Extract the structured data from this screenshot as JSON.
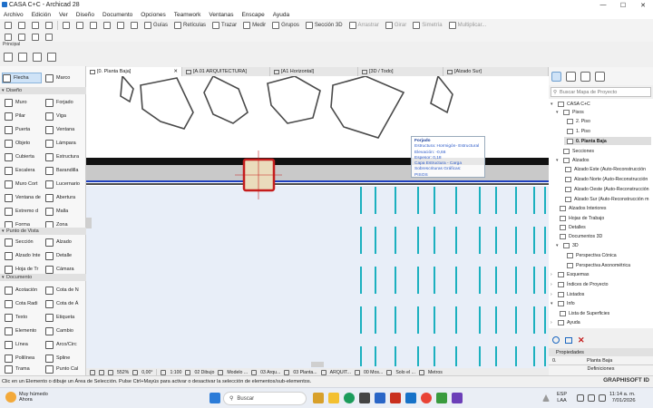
{
  "titlebar": {
    "title": "CASA C+C - Archicad 28",
    "min": "—",
    "max": "☐",
    "close": "✕"
  },
  "menubar": [
    "Archivo",
    "Edición",
    "Ver",
    "Diseño",
    "Documento",
    "Opciones",
    "Teamwork",
    "Ventanas",
    "Enscape",
    "Ayuda"
  ],
  "toolbar1": {
    "guias": "Guías",
    "reticulas": "Retículas",
    "trazar": "Trazar",
    "medir": "Medir",
    "grupos": "Grupos",
    "seccion3d": "Sección 3D",
    "arrastrar": "Arrastrar",
    "girar": "Girar",
    "simetria": "Simetría",
    "multiplicar": "Multiplicar..."
  },
  "principal": "Principal",
  "toolbox": {
    "flecha": "Flecha",
    "marco": "Marco",
    "diseno": "Diseño",
    "muro": "Muro",
    "forjado": "Forjado",
    "pilar": "Pilar",
    "viga": "Viga",
    "puerta": "Puerta",
    "ventana": "Ventana",
    "objeto": "Objeto",
    "lampara": "Lámpara",
    "cubierta": "Cubierta",
    "estructura": "Estructura",
    "escalera": "Escalera",
    "barandilla": "Barandilla",
    "muro_cort": "Muro Cort",
    "lucernario": "Lucernario",
    "ventana_de": "Ventana de",
    "abertura": "Abertura",
    "extremo": "Extremo d",
    "malla": "Malla",
    "forma": "Forma",
    "zona": "Zona",
    "punto_vista": "Punto de Vista",
    "seccion": "Sección",
    "alzado": "Alzado",
    "alzado_int": "Alzado Inte",
    "detalle": "Detalle",
    "hoja_tr": "Hoja de Tr",
    "camara": "Cámara",
    "documento": "Documento",
    "acotacion": "Acotación",
    "cota_n": "Cota de N",
    "cota_radi": "Cota Radi",
    "cota_a": "Cota de Á",
    "texto": "Texto",
    "etiqueta": "Etiqueta",
    "elemento": "Elemento",
    "cambio": "Cambio",
    "linea": "Línea",
    "arco": "Arco/Circ",
    "polilinea": "Polilínea",
    "spline": "Spline",
    "trama": "Trama",
    "punto_cal": "Punto Cal"
  },
  "tabs": [
    {
      "label": "[0. Planta Baja]",
      "close": "✕"
    },
    {
      "label": "[A.01 ARQUITECTURA]"
    },
    {
      "label": "[A1 Horizontal]"
    },
    {
      "label": "[3D / Todo]"
    },
    {
      "label": "[Alzado Sur]"
    }
  ],
  "tooltip": {
    "title": "Forjado",
    "l1": "Estructura: Hormigón- Estructural",
    "l2": "Elevación: -0,66",
    "l3": "Espesor: 0,18",
    "l4": "Capa Estructura - Carga",
    "l5": "Sobrescrituras Gráficas:",
    "l6": "PISOS"
  },
  "statusnav": {
    "zoom": "552%",
    "angle": "0,00°",
    "scale": "1:100",
    "layers": "02 Dibujo",
    "model": "Modelo ...",
    "a": "03 Arqu...",
    "b": "03 Planta...",
    "c": "ARQUIT...",
    "d": "00 Mos...",
    "e": "Solo el ...",
    "units": "Metros"
  },
  "nav": {
    "search": "Buscar Mapa de Proyecto",
    "root": "CASA C+C",
    "pisos": "Pisos",
    "p2": "2. Piso",
    "p1": "1. Piso",
    "p0": "0. Planta Baja",
    "secciones": "Secciones",
    "alzados": "Alzados",
    "az_este": "Alzado Este (Auto-Reconstrucción",
    "az_norte": "Alzado Norte (Auto-Reconstrucción",
    "az_oeste": "Alzado Oeste (Auto-Reconstrucción",
    "az_sur": "Alzado Sur (Auto-Reconstrucción m",
    "alz_int": "Alzados Interiores",
    "hojas": "Hojas de Trabajo",
    "detalles": "Detalles",
    "doc3d": "Documentos 3D",
    "v3d": "3D",
    "persp_con": "Perspectiva Cónica",
    "persp_axo": "Perspectiva Axonométrica",
    "esquemas": "Esquemas",
    "indices": "Índices de Proyecto",
    "listados": "Listados",
    "info": "Info",
    "superficies": "Lista de Superficies",
    "ayuda": "Ayuda"
  },
  "props": {
    "header": "Propiedades",
    "num": "0.",
    "name": "Planta Baja",
    "btn": "Definiciones"
  },
  "hint": "Clic en un Elemento o dibuje un Área de Selección. Pulse Ctrl+Mayús para activar o desactivar la selección de elementos/sub-elementos.",
  "graphisoft": "GRAPHISOFT ID",
  "taskbar": {
    "w1": "Muy húmedo",
    "w2": "Ahora",
    "search": "Buscar",
    "lang1": "ESP",
    "lang2": "LAA",
    "time": "11:14 a. m.",
    "date": "7/01/2026"
  }
}
